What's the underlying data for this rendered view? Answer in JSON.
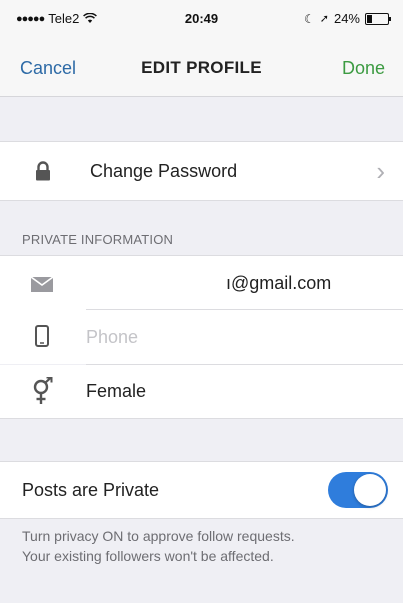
{
  "status_bar": {
    "carrier": "Tele2",
    "time": "20:49",
    "battery_text": "24%",
    "battery_level": 0.24
  },
  "nav": {
    "cancel_label": "Cancel",
    "title": "EDIT PROFILE",
    "done_label": "Done"
  },
  "security": {
    "change_password_label": "Change Password",
    "chevron": "›",
    "icon": "lock-icon"
  },
  "private_info": {
    "header": "PRIVATE INFORMATION",
    "email_value": "ı@gmail.com",
    "email_icon": "mail-icon",
    "phone_placeholder": "Phone",
    "phone_icon": "phone-icon",
    "gender_value": "Female",
    "gender_icon": "gender-icon"
  },
  "privacy": {
    "posts_private_label": "Posts are Private",
    "toggle_on": true,
    "note_line1": "Turn privacy ON to approve follow requests.",
    "note_line2": "Your existing followers won't be affected."
  },
  "colors": {
    "link_blue": "#2d6aa6",
    "done_green": "#3c9b42",
    "toggle_blue": "#2f7ddc",
    "background": "#efeff4"
  }
}
